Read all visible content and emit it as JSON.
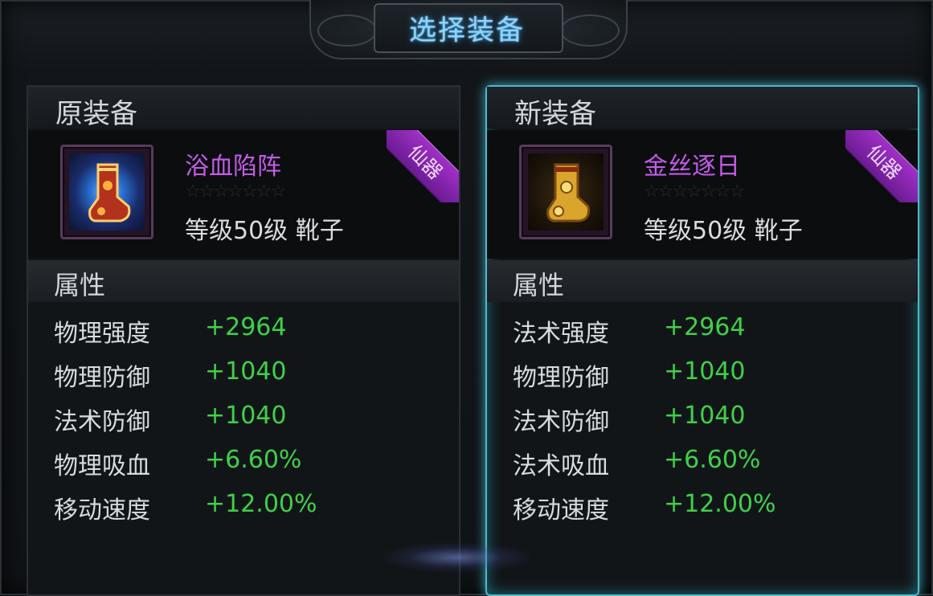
{
  "title": "选择装备",
  "left_panel": {
    "header": "原装备",
    "item": {
      "name": "浴血陷阵",
      "meta": "等级50级  靴子",
      "stars": "☆☆☆☆☆☆☆",
      "tag": "仙器"
    },
    "attr_header": "属性",
    "stats": [
      {
        "name": "物理强度",
        "value": "+2964"
      },
      {
        "name": "物理防御",
        "value": "+1040"
      },
      {
        "name": "法术防御",
        "value": "+1040"
      },
      {
        "name": "物理吸血",
        "value": "+6.60%"
      },
      {
        "name": "移动速度",
        "value": "+12.00%"
      }
    ]
  },
  "right_panel": {
    "header": "新装备",
    "item": {
      "name": "金丝逐日",
      "meta": "等级50级  靴子",
      "stars": "☆☆☆☆☆☆☆",
      "tag": "仙器"
    },
    "attr_header": "属性",
    "stats": [
      {
        "name": "法术强度",
        "value": "+2964"
      },
      {
        "name": "物理防御",
        "value": "+1040"
      },
      {
        "name": "法术防御",
        "value": "+1040"
      },
      {
        "name": "法术吸血",
        "value": "+6.60%"
      },
      {
        "name": "移动速度",
        "value": "+12.00%"
      }
    ]
  },
  "colors": {
    "accent": "#4fb8c8",
    "item_name": "#c45be8",
    "stat_value": "#3fd14a",
    "title": "#8fd4ff"
  },
  "icons": {
    "left_item": "red-boot-icon",
    "right_item": "gold-boot-icon"
  }
}
